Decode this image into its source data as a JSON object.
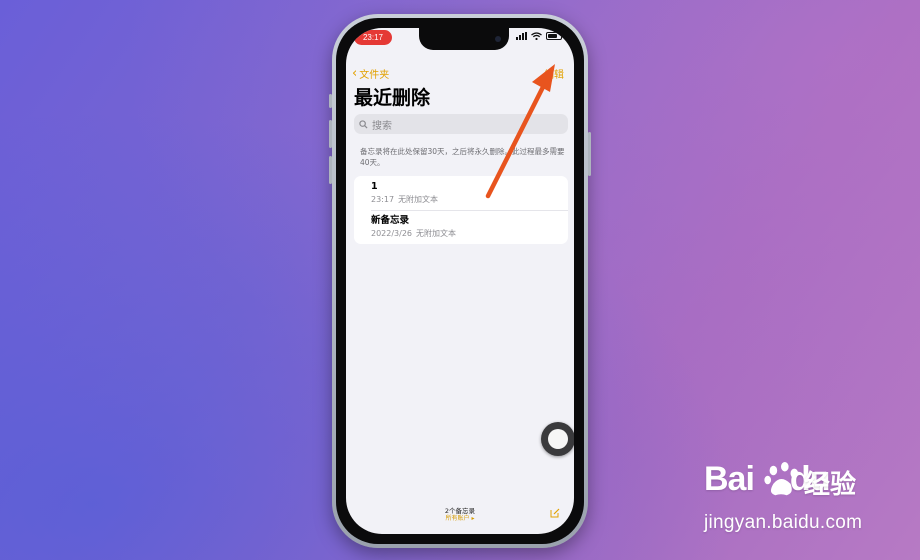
{
  "status_bar": {
    "time": "23:17"
  },
  "nav": {
    "back_label": "文件夹",
    "edit_label": "编辑"
  },
  "page": {
    "title": "最近删除"
  },
  "search": {
    "placeholder": "搜索"
  },
  "info": {
    "text": "备忘录将在此处保留30天，之后将永久删除。此过程最多需要40天。"
  },
  "notes": [
    {
      "title": "1",
      "time": "23:17",
      "preview": "无附加文本"
    },
    {
      "title": "新备忘录",
      "time": "2022/3/26",
      "preview": "无附加文本"
    }
  ],
  "footer": {
    "count": "2个备忘录",
    "sub": "所有账户 ▸"
  },
  "watermark": {
    "logo_text": "Bai",
    "logo_suffix": "du",
    "brand": "经验",
    "url": "jingyan.baidu.com"
  },
  "colors": {
    "accent": "#e2a100",
    "arrow": "#e8541e",
    "time_pill": "#e53935"
  },
  "icons": [
    "chevron-left-icon",
    "search-icon",
    "compose-icon",
    "assistive-touch-icon",
    "wifi-icon",
    "battery-icon",
    "signal-icon"
  ]
}
